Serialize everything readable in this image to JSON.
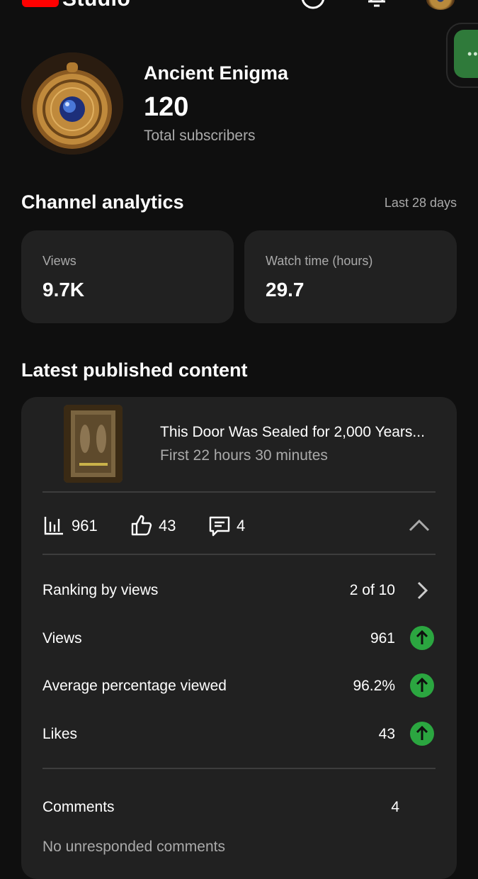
{
  "topbar": {
    "logo_text": "Studio",
    "icons": [
      "help-icon",
      "notifications-icon",
      "account-avatar"
    ]
  },
  "channel": {
    "name": "Ancient Enigma",
    "subscribers": "120",
    "subscribers_label": "Total subscribers"
  },
  "analytics": {
    "title": "Channel analytics",
    "range": "Last 28 days",
    "views_label": "Views",
    "views_value": "9.7K",
    "watch_label": "Watch time (hours)",
    "watch_value": "29.7"
  },
  "latest": {
    "title": "Latest published content",
    "video_title": "This Door Was Sealed for 2,000 Years...",
    "video_sub": "First 22 hours 30 minutes",
    "metrics": {
      "views": "961",
      "likes": "43",
      "comments": "4"
    },
    "rows": [
      {
        "label": "Ranking by views",
        "value": "2 of 10"
      },
      {
        "label": "Views",
        "value": "961"
      },
      {
        "label": "Average percentage viewed",
        "value": "96.2%"
      },
      {
        "label": "Likes",
        "value": "43"
      }
    ],
    "comments_label": "Comments",
    "comments_value": "4",
    "unresponded": "No unresponded comments"
  },
  "colors": {
    "background": "#0f0f0f",
    "card": "#212121",
    "accent_up": "#2ba640",
    "brand_red": "#ff0000"
  }
}
